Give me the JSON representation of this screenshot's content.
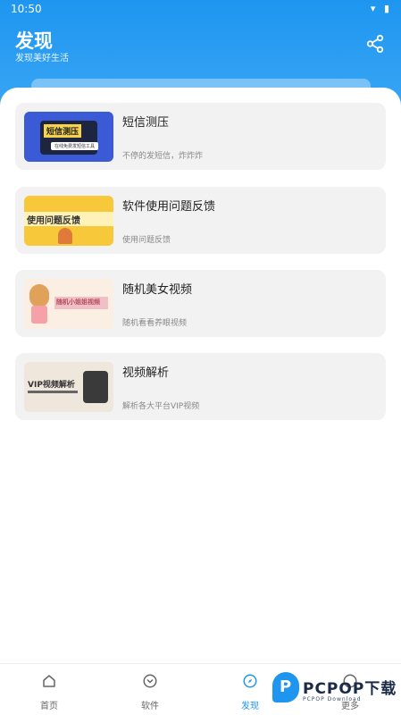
{
  "status_bar": {
    "time": "10:50",
    "icons": "▾ ▮"
  },
  "header": {
    "title": "发现",
    "subtitle": "发现美好生活",
    "share_icon": "share-icon"
  },
  "cards": [
    {
      "title": "短信测压",
      "desc": "不停的发短信，炸炸炸",
      "thumb_text": "短信测压",
      "thumb_sub": "在线免费发短信工具"
    },
    {
      "title": "软件使用问题反馈",
      "desc": "使用问题反馈",
      "thumb_text": "使用问题反馈"
    },
    {
      "title": "随机美女视频",
      "desc": "随机看看养眼视频",
      "thumb_text": "随机小姐姐视频"
    },
    {
      "title": "视频解析",
      "desc": "解析各大平台VIP视频",
      "thumb_text": "VIP视频解析"
    }
  ],
  "tabbar": [
    {
      "label": "首页",
      "icon": "home-icon"
    },
    {
      "label": "软件",
      "icon": "compass-clock-icon"
    },
    {
      "label": "发现",
      "icon": "compass-icon",
      "active": true
    },
    {
      "label": "更多",
      "icon": "more-icon"
    }
  ],
  "watermark": {
    "letter": "P",
    "name": "PCPOP下载",
    "sub": "PCPOP Download"
  },
  "colors": {
    "accent": "#1e96f0",
    "card_bg": "#f2f2f2"
  }
}
